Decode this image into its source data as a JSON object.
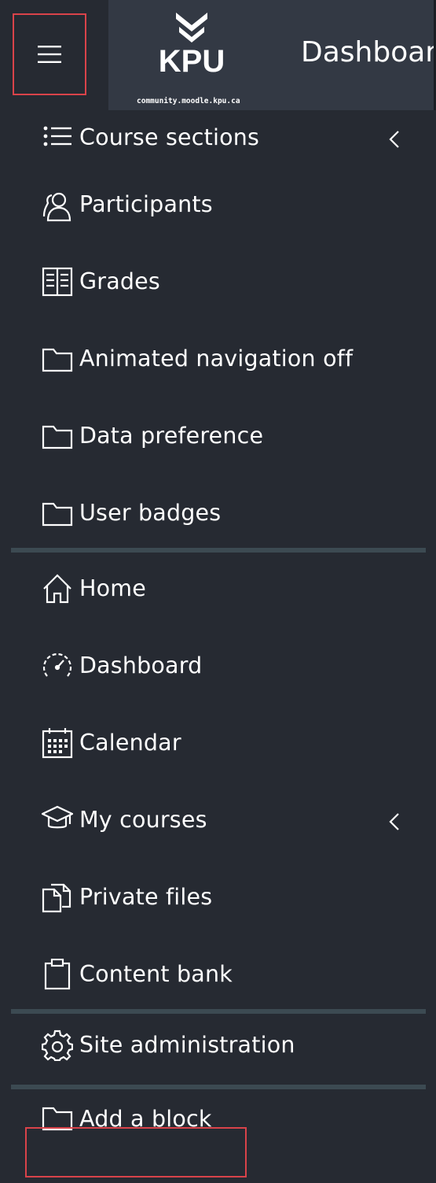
{
  "header": {
    "menu_label": "",
    "logo_text": "KPU",
    "logo_subtext": "community.moodle.kpu.ca",
    "page_title": "Dashboard"
  },
  "nav": {
    "course_section": [
      {
        "label": "Course sections",
        "icon": "list-icon",
        "expandable": true
      },
      {
        "label": "Participants",
        "icon": "users-icon"
      },
      {
        "label": "Grades",
        "icon": "gradebook-icon"
      },
      {
        "label": "Animated navigation off",
        "icon": "folder-icon"
      },
      {
        "label": "Data preference",
        "icon": "folder-icon"
      },
      {
        "label": "User badges",
        "icon": "folder-icon"
      }
    ],
    "site_section": [
      {
        "label": "Home",
        "icon": "home-icon"
      },
      {
        "label": "Dashboard",
        "icon": "dashboard-gauge-icon"
      },
      {
        "label": "Calendar",
        "icon": "calendar-icon"
      },
      {
        "label": "My courses",
        "icon": "graduation-cap-icon",
        "expandable": true
      },
      {
        "label": "Private files",
        "icon": "files-icon"
      },
      {
        "label": "Content bank",
        "icon": "clipboard-icon"
      }
    ],
    "admin_section": [
      {
        "label": "Site administration",
        "icon": "gear-icon"
      }
    ],
    "block_section": [
      {
        "label": "Add a block",
        "icon": "folder-icon"
      }
    ]
  },
  "colors": {
    "background": "#262a32",
    "logo_panel": "#333944",
    "divider": "#3c4a52",
    "highlight": "#d9434a",
    "text": "#ffffff"
  }
}
